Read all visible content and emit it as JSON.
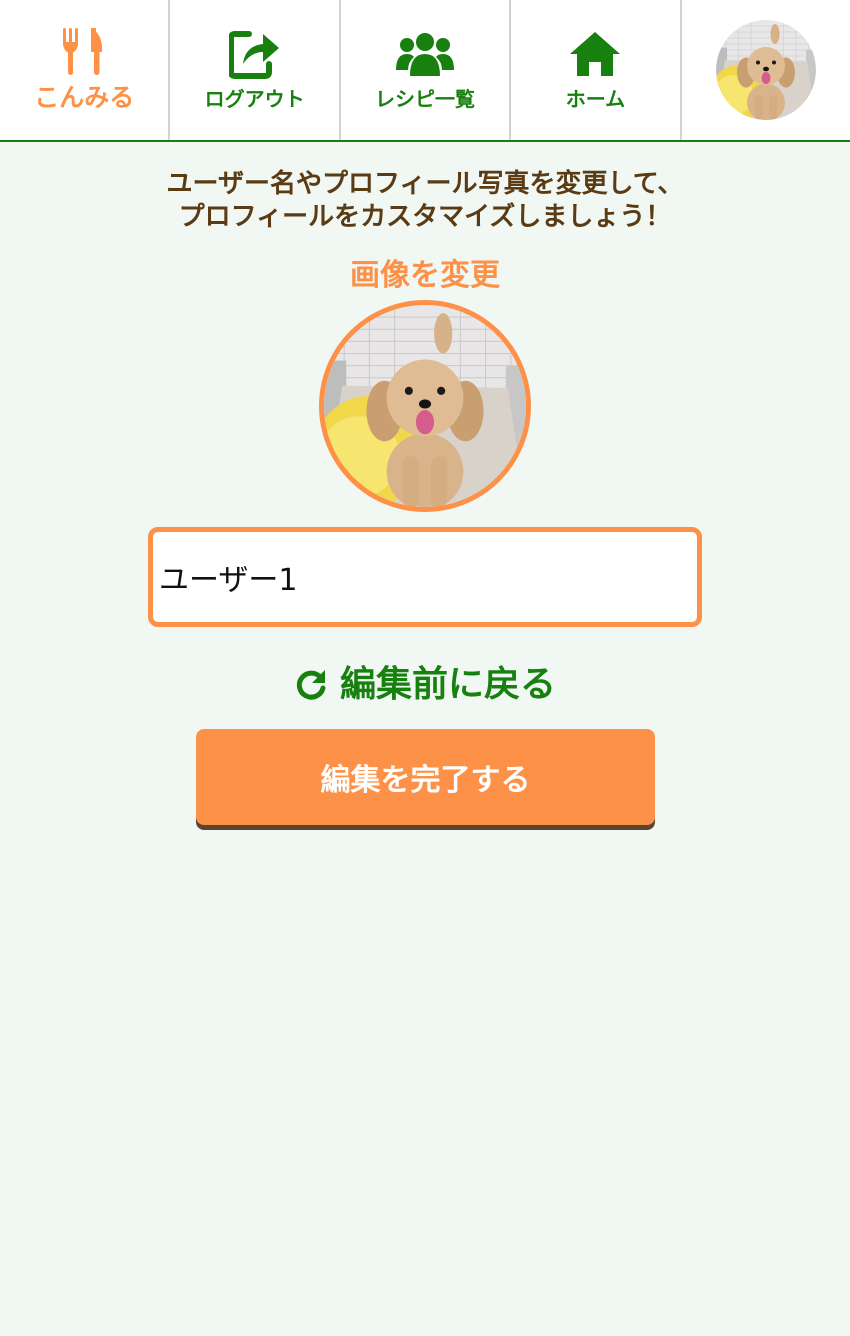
{
  "nav": {
    "logo_label": "こんみる",
    "logout_label": "ログアウト",
    "recipes_label": "レシピ一覧",
    "home_label": "ホーム",
    "logo_icon": "fork-knife-icon",
    "logout_icon": "share-out-icon",
    "recipes_icon": "users-icon",
    "home_icon": "home-icon",
    "avatar_image": "poodle-photo"
  },
  "profile_edit": {
    "intro_line1": "ユーザー名やプロフィール写真を変更して、",
    "intro_line2": "プロフィールをカスタマイズしましょう！",
    "change_image_label": "画像を変更",
    "username_value": "ユーザー1",
    "revert_label": "編集前に戻る",
    "revert_icon": "redo-icon",
    "submit_label": "編集を完了する"
  },
  "colors": {
    "accent_orange": "#fd9147",
    "brand_green": "#17800f",
    "text_brown": "#5a3b14",
    "page_background": "#f1f8f3"
  }
}
